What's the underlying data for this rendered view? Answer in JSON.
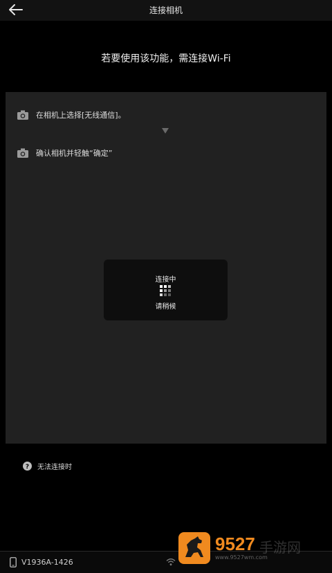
{
  "header": {
    "title": "连接相机"
  },
  "main": {
    "subtitle": "若要使用该功能，需连接Wi-Fi",
    "steps": [
      {
        "icon": "camera-icon",
        "label": "在相机上选择[无线通信]。"
      },
      {
        "icon": "camera-icon",
        "label": "确认相机并轻触“确定”"
      }
    ],
    "dialog": {
      "status": "连接中",
      "wait": "请稍候"
    }
  },
  "help": {
    "label": "无法连接时"
  },
  "footer": {
    "device": "V1936A-1426"
  },
  "watermark": {
    "brand": "9527",
    "brand_suffix": "手游网",
    "url": "www.9527wm.com"
  },
  "colors": {
    "background": "#000000",
    "panel": "#212121",
    "watermark_orange": "#f08a1f"
  }
}
